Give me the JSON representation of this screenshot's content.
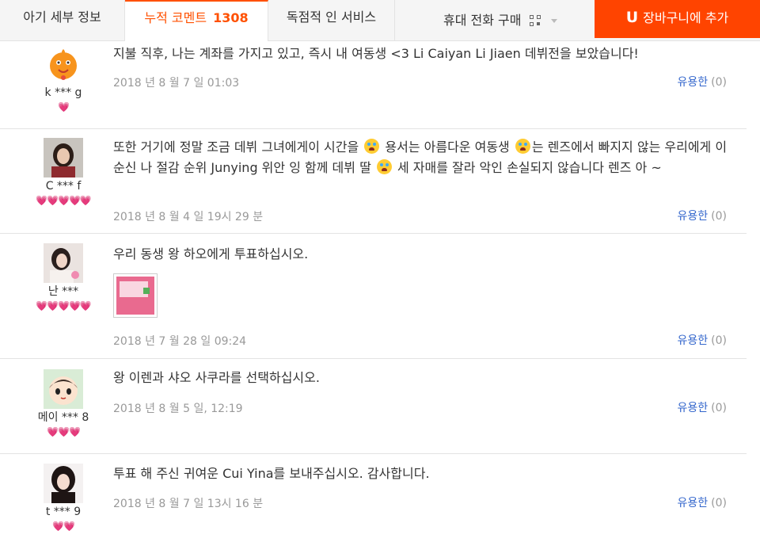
{
  "tabs": {
    "details": "아기 세부 정보",
    "comments_label": "누적 코멘트",
    "comments_count": "1308",
    "service": "독점적 인 서비스"
  },
  "mobile_purchase": "휴대 전화 구매",
  "cart_button": {
    "icon_letter": "U",
    "label": "장바구니에 추가"
  },
  "reviews": [
    {
      "user": "k *** g",
      "hearts": "💗",
      "text": "지불 직후, 나는 계좌를 가지고 있고, 즉시 내 여동생 <3 Li Caiyan Li Jiaen 데뷔전을 보았습니다!",
      "date": "2018 년 8 월 7 일 01:03",
      "helpful": "유용한",
      "helpful_count": "(0)"
    },
    {
      "user": "C *** f",
      "hearts": "💗💗💗💗💗",
      "text_parts": [
        "또한 거기에 정말 조금 데뷔 그녀에게이 시간을 ",
        " 용서는 아름다운 여동생 ",
        "는 렌즈에서 빠지지 않는 우리에게 이순신 나 절감 순위 Junying 위안 잉 함께 데뷔 딸 ",
        " 세 자매를 잘라 악인 손실되지 않습니다 렌즈 아 ~"
      ],
      "date": "2018 년 8 월 4 일 19시 29 분",
      "helpful": "유용한",
      "helpful_count": "(0)"
    },
    {
      "user": "난 ***",
      "hearts": "💗💗💗💗💗",
      "text": "우리 동생 왕 하오에게 투표하십시오.",
      "date": "2018 년 7 월 28 일 09:24",
      "helpful": "유용한",
      "helpful_count": "(0)"
    },
    {
      "user": "메이 *** 8",
      "hearts": "💗💗💗",
      "text": "왕 이렌과 샤오 사쿠라를 선택하십시오.",
      "date": "2018 년 8 월 5 일, 12:19",
      "helpful": "유용한",
      "helpful_count": "(0)"
    },
    {
      "user": "t *** 9",
      "hearts": "💗💗",
      "text": "투표 해 주신 귀여운 Cui Yina를 보내주십시오. 감사합니다.",
      "date": "2018 년 8 월 7 일 13시 16 분",
      "helpful": "유용한",
      "helpful_count": "(0)"
    }
  ],
  "colors": {
    "accent": "#ff5000",
    "cart": "#ff4400",
    "link": "#3366cc",
    "heart": "#e83a4a"
  },
  "icons": [
    "qr-code-icon",
    "chevron-down-icon",
    "crying-emoji-icon",
    "heart-icon"
  ]
}
